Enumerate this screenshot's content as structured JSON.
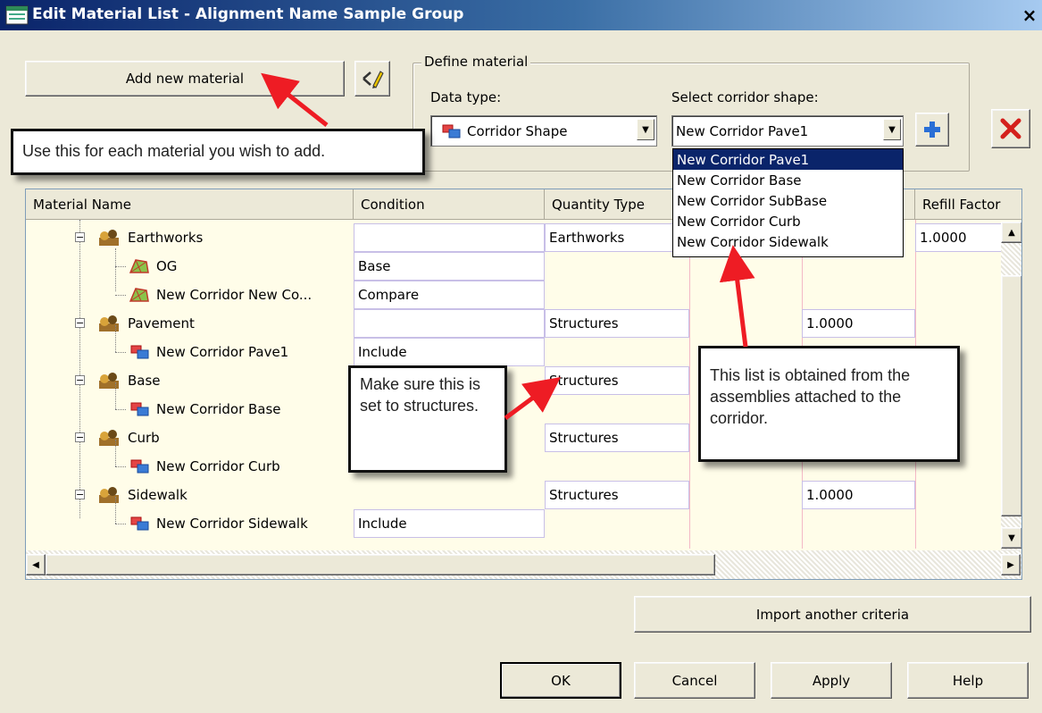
{
  "window": {
    "title": "Edit Material List - Alignment Name Sample Group",
    "close": "×"
  },
  "toolbar": {
    "add_material": "Add new material"
  },
  "define": {
    "group_label": "Define material",
    "data_type_label": "Data type:",
    "data_type_value": "Corridor Shape",
    "shape_label": "Select corridor shape:",
    "shape_value": "New Corridor Pave1",
    "add_symbol": "+",
    "delete_symbol": "✕"
  },
  "dropdown": {
    "items": [
      "New Corridor Pave1",
      "New Corridor Base",
      "New Corridor SubBase",
      "New Corridor Curb",
      "New Corridor Sidewalk"
    ],
    "selected_index": 0
  },
  "grid": {
    "headers": [
      "Material Name",
      "Condition",
      "Quantity Type",
      "",
      "",
      "Refill Factor"
    ],
    "rows": [
      {
        "name": "Earthworks",
        "condition": "",
        "qty_type": "Earthworks",
        "factor": "",
        "refill": "1.0000"
      },
      {
        "name": "OG",
        "condition": "Base",
        "qty_type": "",
        "factor": "",
        "refill": ""
      },
      {
        "name": "New Corridor New Co...",
        "condition": "Compare",
        "qty_type": "",
        "factor": "",
        "refill": ""
      },
      {
        "name": "Pavement",
        "condition": "",
        "qty_type": "Structures",
        "factor": "1.0000",
        "refill": ""
      },
      {
        "name": "New Corridor Pave1",
        "condition": "Include",
        "qty_type": "",
        "factor": "",
        "refill": ""
      },
      {
        "name": "Base",
        "condition": "",
        "qty_type": "Structures",
        "factor": "",
        "refill": ""
      },
      {
        "name": "New Corridor Base",
        "condition": "",
        "qty_type": "",
        "factor": "",
        "refill": ""
      },
      {
        "name": "Curb",
        "condition": "",
        "qty_type": "Structures",
        "factor": "",
        "refill": ""
      },
      {
        "name": "New Corridor Curb",
        "condition": "",
        "qty_type": "",
        "factor": "",
        "refill": ""
      },
      {
        "name": "Sidewalk",
        "condition": "",
        "qty_type": "Structures",
        "factor": "1.0000",
        "refill": ""
      },
      {
        "name": "New Corridor Sidewalk",
        "condition": "Include",
        "qty_type": "",
        "factor": "",
        "refill": ""
      }
    ]
  },
  "callouts": {
    "add_material": "Use this for each material you wish to add.",
    "structures": "Make sure this is set to structures.",
    "list_source": "This list is obtained from the assemblies attached to the corridor."
  },
  "buttons": {
    "import": "Import another criteria",
    "ok": "OK",
    "cancel": "Cancel",
    "apply": "Apply",
    "help": "Help"
  },
  "colors": {
    "accent": "#0a246a",
    "arrow": "#ee1c24",
    "delete": "#d4201c"
  }
}
